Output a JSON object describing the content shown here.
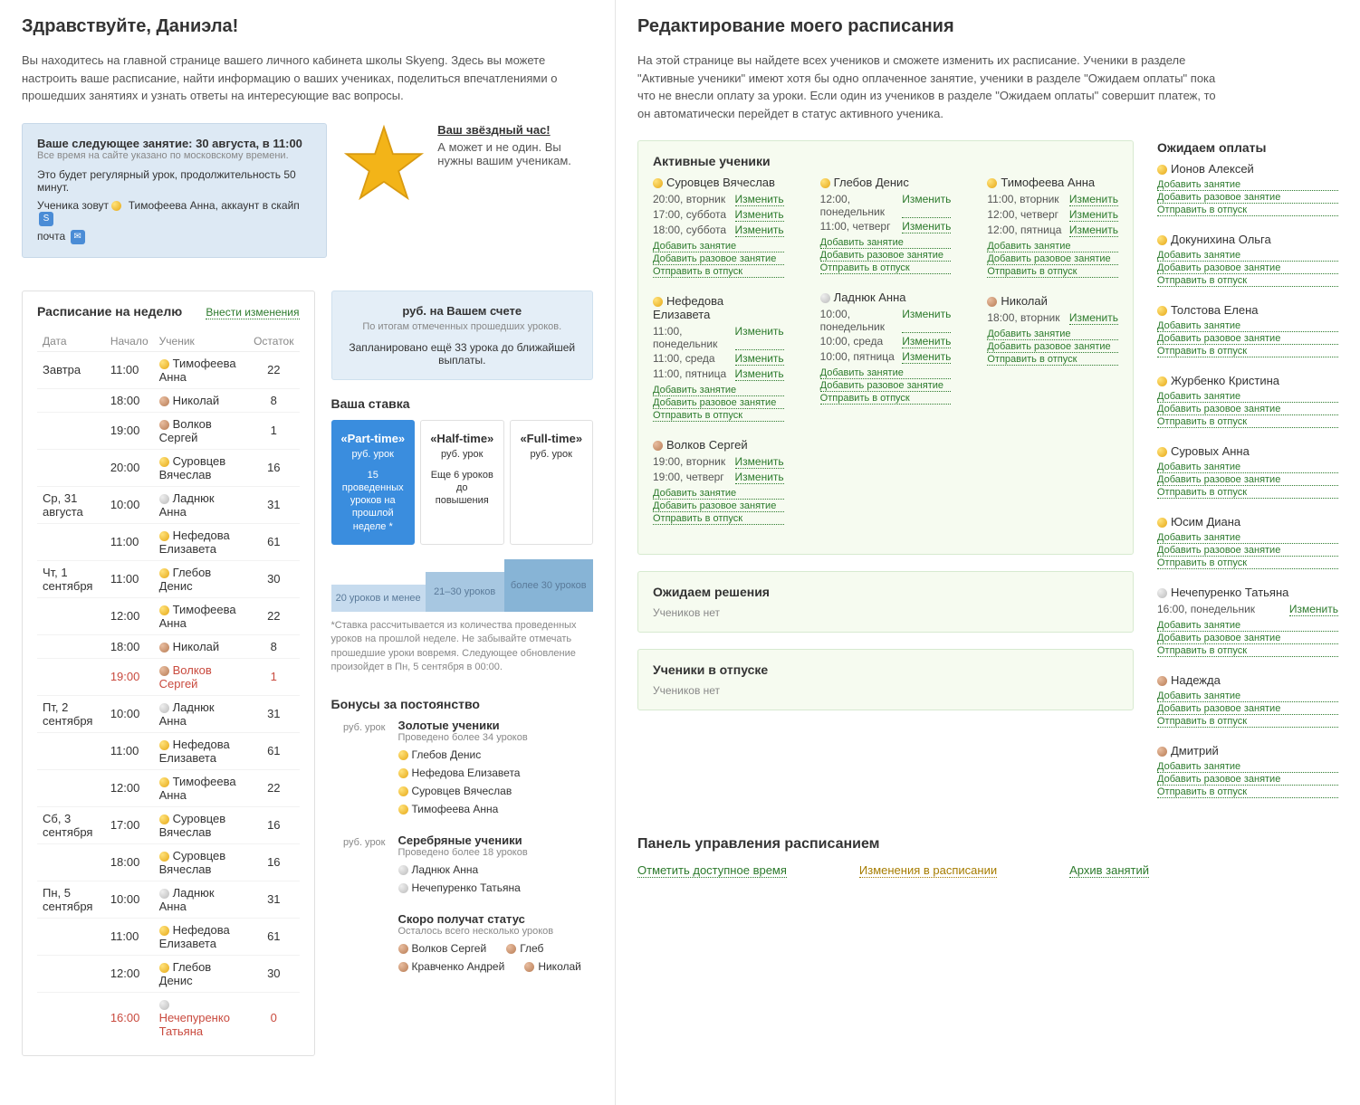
{
  "left": {
    "greeting": "Здравствуйте, Даниэла!",
    "intro": "Вы находитесь на главной странице вашего личного кабинета школы Skyeng. Здесь вы можете настроить ваше расписание, найти информацию о ваших учениках, поделиться впечатлениями о прошедших занятиях и узнать ответы на интересующие вас вопросы.",
    "next_lesson": {
      "title": "Ваше следующее занятие: 30 августа, в 11:00",
      "tz_note": "Все время на сайте указано по московскому времени.",
      "desc": "Это будет регулярный урок, продолжительность 50 минут.",
      "student_prefix": "Ученика зовут",
      "student_name": "Тимофеева Анна",
      "skype_prefix": ", аккаунт в скайп",
      "mail_prefix": "почта"
    },
    "star": {
      "title": "Ваш звёздный час!",
      "sub": "А может и не один. Вы нужны вашим ученикам."
    },
    "account": {
      "label": "руб. на Вашем счете",
      "line1": "По итогам отмеченных прошедших уроков.",
      "line2": "Запланировано ещё 33 урока до ближайшей выплаты."
    },
    "schedule": {
      "title": "Расписание на неделю",
      "edit_link": "Внести изменения",
      "cols": {
        "date": "Дата",
        "start": "Начало",
        "student": "Ученик",
        "rest": "Остаток"
      },
      "rows": [
        {
          "date": "Завтра",
          "time": "11:00",
          "dot": "gold",
          "name": "Тимофеева Анна",
          "rest": "22"
        },
        {
          "date": "",
          "time": "18:00",
          "dot": "bronze",
          "name": "Николай",
          "rest": "8"
        },
        {
          "date": "",
          "time": "19:00",
          "dot": "bronze",
          "name": "Волков Сергей",
          "rest": "1"
        },
        {
          "date": "",
          "time": "20:00",
          "dot": "gold",
          "name": "Суровцев Вячеслав",
          "rest": "16"
        },
        {
          "date": "Ср, 31 августа",
          "time": "10:00",
          "dot": "silver",
          "name": "Ладнюк Анна",
          "rest": "31"
        },
        {
          "date": "",
          "time": "11:00",
          "dot": "gold",
          "name": "Нефедова Елизавета",
          "rest": "61"
        },
        {
          "date": "Чт, 1 сентября",
          "time": "11:00",
          "dot": "gold",
          "name": "Глебов Денис",
          "rest": "30"
        },
        {
          "date": "",
          "time": "12:00",
          "dot": "gold",
          "name": "Тимофеева Анна",
          "rest": "22"
        },
        {
          "date": "",
          "time": "18:00",
          "dot": "bronze",
          "name": "Николай",
          "rest": "8"
        },
        {
          "date": "",
          "time": "19:00",
          "dot": "bronze",
          "name": "Волков Сергей",
          "rest": "1",
          "red": true
        },
        {
          "date": "Пт, 2 сентября",
          "time": "10:00",
          "dot": "silver",
          "name": "Ладнюк Анна",
          "rest": "31"
        },
        {
          "date": "",
          "time": "11:00",
          "dot": "gold",
          "name": "Нефедова Елизавета",
          "rest": "61"
        },
        {
          "date": "",
          "time": "12:00",
          "dot": "gold",
          "name": "Тимофеева Анна",
          "rest": "22"
        },
        {
          "date": "Сб, 3 сентября",
          "time": "17:00",
          "dot": "gold",
          "name": "Суровцев Вячеслав",
          "rest": "16"
        },
        {
          "date": "",
          "time": "18:00",
          "dot": "gold",
          "name": "Суровцев Вячеслав",
          "rest": "16"
        },
        {
          "date": "Пн, 5 сентября",
          "time": "10:00",
          "dot": "silver",
          "name": "Ладнюк Анна",
          "rest": "31"
        },
        {
          "date": "",
          "time": "11:00",
          "dot": "gold",
          "name": "Нефедова Елизавета",
          "rest": "61"
        },
        {
          "date": "",
          "time": "12:00",
          "dot": "gold",
          "name": "Глебов Денис",
          "rest": "30"
        },
        {
          "date": "",
          "time": "16:00",
          "dot": "silver",
          "name": "Нечепуренко Татьяна",
          "rest": "0",
          "red": true
        }
      ]
    },
    "rate": {
      "title": "Ваша ставка",
      "cards": [
        {
          "name": "«Part-time»",
          "price": "руб. урок",
          "sub": "15 проведенных уроков на прошлой неделе *",
          "active": true
        },
        {
          "name": "«Half-time»",
          "price": "руб. урок",
          "sub": "Еще 6 уроков до повышения"
        },
        {
          "name": "«Full-time»",
          "price": "руб. урок",
          "sub": ""
        }
      ],
      "bars": {
        "b1": "20 уроков и менее",
        "b2": "21–30 уроков",
        "b3": "более 30 уроков"
      },
      "note": "*Ставка рассчитывается из количества проведенных уроков на прошлой неделе. Не забывайте отмечать прошедшие уроки вовремя. Следующее обновление произойдет в Пн, 5 сентября в 00:00."
    },
    "bonus": {
      "title": "Бонусы за постоянство",
      "gold": {
        "lbl": "руб. урок",
        "title": "Золотые ученики",
        "sub": "Проведено более 34 уроков",
        "names": [
          [
            "gold",
            "Глебов Денис"
          ],
          [
            "gold",
            "Нефедова Елизавета"
          ],
          [
            "gold",
            "Суровцев Вячеслав"
          ],
          [
            "gold",
            "Тимофеева Анна"
          ]
        ]
      },
      "silver": {
        "lbl": "руб. урок",
        "title": "Серебряные ученики",
        "sub": "Проведено более 18 уроков",
        "names": [
          [
            "silver",
            "Ладнюк Анна"
          ],
          [
            "silver",
            "Нечепуренко Татьяна"
          ]
        ]
      },
      "soon": {
        "title": "Скоро получат статус",
        "sub": "Осталось всего несколько уроков",
        "names": [
          [
            "bronze",
            "Волков Сергей"
          ],
          [
            "bronze",
            "Глеб"
          ],
          [
            "bronze",
            "Кравченко Андрей"
          ],
          [
            "bronze",
            "Николай"
          ]
        ]
      }
    }
  },
  "right": {
    "title": "Редактирование моего расписания",
    "intro": "На этой странице вы найдете всех учеников и сможете изменить их расписание. Ученики в разделе \"Активные ученики\" имеют хотя бы одно оплаченное занятие, ученики в разделе \"Ожидаем оплаты\" пока что не внесли оплату за уроки. Если один из учеников в разделе \"Ожидаем оплаты\" совершит платеж, то он автоматически перейдет в статус активного ученика.",
    "links": {
      "edit": "Изменить",
      "add": "Добавить занятие",
      "add_once": "Добавить разовое занятие",
      "vacation": "Отправить в отпуск"
    },
    "active": {
      "title": "Активные ученики",
      "cols": [
        [
          {
            "dot": "gold",
            "name": "Суровцев Вячеслав",
            "times": [
              "20:00, вторник",
              "17:00, суббота",
              "18:00, суббота"
            ]
          },
          {
            "dot": "gold",
            "name": "Нефедова Елизавета",
            "times": [
              "11:00, понедельник",
              "11:00, среда",
              "11:00, пятница"
            ]
          },
          {
            "dot": "bronze",
            "name": "Волков Сергей",
            "times": [
              "19:00, вторник",
              "19:00, четверг"
            ]
          }
        ],
        [
          {
            "dot": "gold",
            "name": "Глебов Денис",
            "times": [
              "12:00, понедельник",
              "11:00, четверг"
            ]
          },
          {
            "dot": "silver",
            "name": "Ладнюк Анна",
            "times": [
              "10:00, понедельник",
              "10:00, среда",
              "10:00, пятница"
            ]
          }
        ],
        [
          {
            "dot": "gold",
            "name": "Тимофеева Анна",
            "times": [
              "11:00, вторник",
              "12:00, четверг",
              "12:00, пятница"
            ]
          },
          {
            "dot": "bronze",
            "name": "Николай",
            "times": [
              "18:00, вторник"
            ]
          }
        ]
      ]
    },
    "waiting_decision": {
      "title": "Ожидаем решения",
      "empty": "Учеников нет"
    },
    "on_vacation": {
      "title": "Ученики в отпуске",
      "empty": "Учеников нет"
    },
    "await_pay": {
      "title": "Ожидаем оплаты",
      "students": [
        {
          "dot": "gold",
          "name": "Ионов Алексей"
        },
        {
          "dot": "gold",
          "name": "Докунихина Ольга"
        },
        {
          "dot": "gold",
          "name": "Толстова Елена"
        },
        {
          "dot": "gold",
          "name": "Журбенко Кристина"
        },
        {
          "dot": "gold",
          "name": "Суровых Анна"
        },
        {
          "dot": "gold",
          "name": "Юсим Диана"
        },
        {
          "dot": "silver",
          "name": "Нечепуренко Татьяна",
          "times": [
            "16:00, понедельник"
          ]
        },
        {
          "dot": "bronze",
          "name": "Надежда"
        },
        {
          "dot": "bronze",
          "name": "Дмитрий"
        }
      ]
    },
    "panel": {
      "title": "Панель управления расписанием",
      "links": [
        "Отметить доступное время",
        "Изменения в расписании",
        "Архив занятий"
      ]
    }
  }
}
